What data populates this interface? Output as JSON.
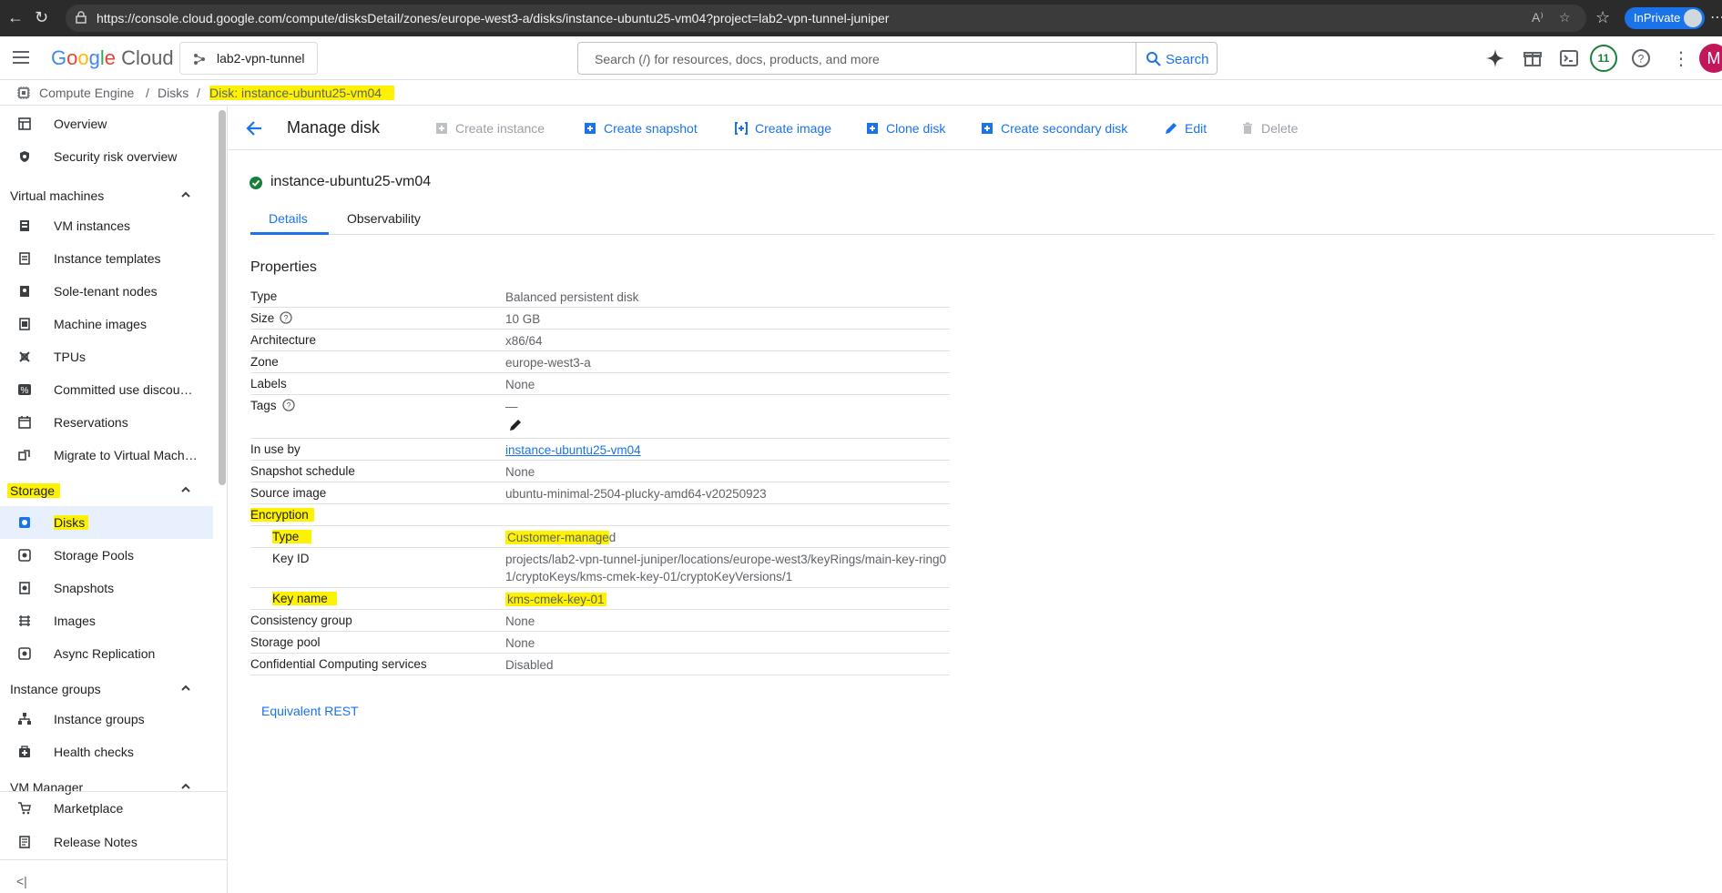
{
  "browser": {
    "url": "https://console.cloud.google.com/compute/disksDetail/zones/europe-west3-a/disks/instance-ubuntu25-vm04?project=lab2-vpn-tunnel-juniper",
    "inprivate_label": "InPrivate"
  },
  "topbar": {
    "logo_google": [
      "G",
      "o",
      "o",
      "g",
      "l",
      "e"
    ],
    "logo_cloud": "Cloud",
    "project": "lab2-vpn-tunnel",
    "search_placeholder": "Search (/) for resources, docs, products, and more",
    "search_button": "Search",
    "notifications_count": "11",
    "account_initial": "M"
  },
  "breadcrumb": {
    "items": [
      "Compute Engine",
      "Disks",
      "Disk: instance-ubuntu25-vm04"
    ]
  },
  "sidebar": {
    "top_items": [
      {
        "label": "Overview",
        "icon": "overview-icon"
      },
      {
        "label": "Security risk overview",
        "icon": "shield-icon"
      }
    ],
    "sections": [
      {
        "title": "Virtual machines",
        "items": [
          "VM instances",
          "Instance templates",
          "Sole-tenant nodes",
          "Machine images",
          "TPUs",
          "Committed use discounts",
          "Reservations",
          "Migrate to Virtual Machines"
        ]
      },
      {
        "title": "Storage",
        "items": [
          "Disks",
          "Storage Pools",
          "Snapshots",
          "Images",
          "Async Replication"
        ]
      },
      {
        "title": "Instance groups",
        "items": [
          "Instance groups",
          "Health checks"
        ]
      },
      {
        "title": "VM Manager",
        "items": []
      }
    ],
    "bottom_items": [
      "Marketplace",
      "Release Notes"
    ]
  },
  "toolbar": {
    "title": "Manage disk",
    "actions": [
      {
        "label": "Create instance",
        "enabled": false
      },
      {
        "label": "Create snapshot",
        "enabled": true
      },
      {
        "label": "Create image",
        "enabled": true
      },
      {
        "label": "Clone disk",
        "enabled": true
      },
      {
        "label": "Create secondary disk",
        "enabled": true
      },
      {
        "label": "Edit",
        "enabled": true
      },
      {
        "label": "Delete",
        "enabled": false
      }
    ]
  },
  "resource": {
    "name": "instance-ubuntu25-vm04",
    "status_color": "#188038",
    "tabs": [
      "Details",
      "Observability"
    ]
  },
  "properties": {
    "title": "Properties",
    "type": {
      "label": "Type",
      "value": "Balanced persistent disk"
    },
    "size": {
      "label": "Size",
      "value": "10 GB"
    },
    "architecture": {
      "label": "Architecture",
      "value": "x86/64"
    },
    "zone": {
      "label": "Zone",
      "value": "europe-west3-a"
    },
    "labels": {
      "label": "Labels",
      "value": "None"
    },
    "tags": {
      "label": "Tags",
      "value": "—"
    },
    "in_use_by": {
      "label": "In use by",
      "value": "instance-ubuntu25-vm04"
    },
    "snapshot_schedule": {
      "label": "Snapshot schedule",
      "value": "None"
    },
    "source_image": {
      "label": "Source image",
      "value": "ubuntu-minimal-2504-plucky-amd64-v20250923"
    },
    "encryption": {
      "label": "Encryption"
    },
    "enc_type": {
      "label": "Type",
      "value_hl": "Customer-manage",
      "value_rest": "d"
    },
    "key_id": {
      "label": "Key ID",
      "value": "projects/lab2-vpn-tunnel-juniper/locations/europe-west3/keyRings/main-key-ring01/cryptoKeys/kms-cmek-key-01/cryptoKeyVersions/1"
    },
    "key_name": {
      "label": "Key name",
      "value": "kms-cmek-key-01"
    },
    "consistency_group": {
      "label": "Consistency group",
      "value": "None"
    },
    "storage_pool": {
      "label": "Storage pool",
      "value": "None"
    },
    "confidential": {
      "label": "Confidential Computing services",
      "value": "Disabled"
    }
  },
  "equivalent_rest": "Equivalent REST",
  "colors": {
    "accent": "#1a73e8",
    "highlight": "#fff200",
    "disabled": "#9aa0a6"
  }
}
